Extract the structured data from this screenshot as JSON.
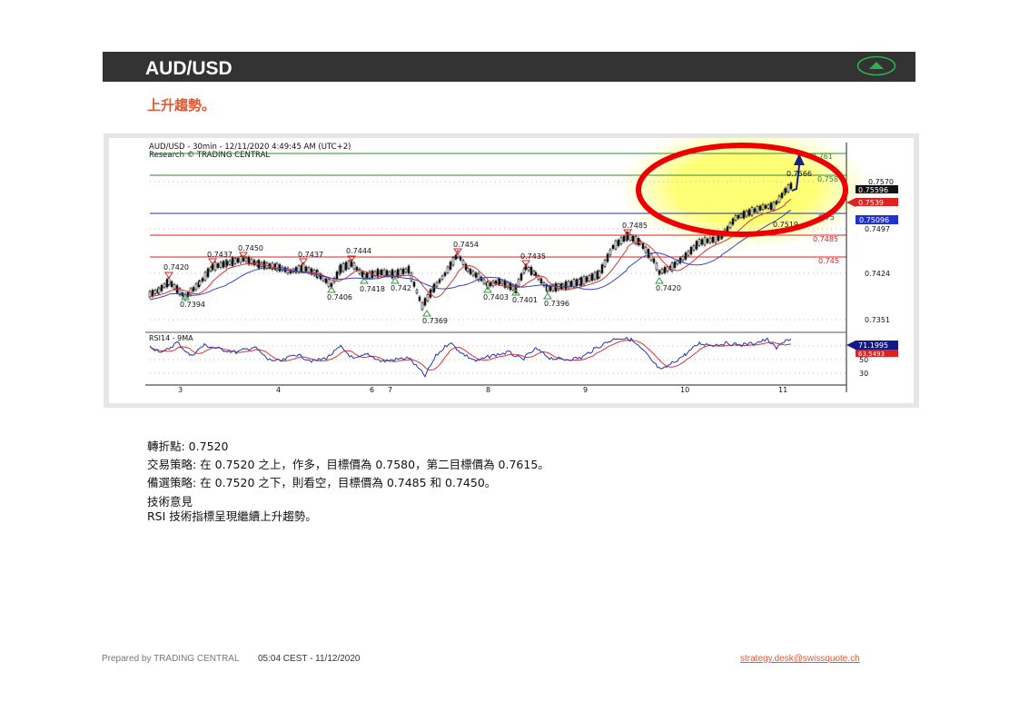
{
  "header": {
    "pair": "AUD/USD",
    "trend_icon": "up-triangle-icon",
    "accent_color": "#e8552a",
    "bar_color": "#333333"
  },
  "subtitle": "上升趨勢。",
  "chart": {
    "header_line": "AUD/USD - 30min - 12/11/2020 4:49:45 AM (UTC+2)",
    "research_line": "Research © TRADING CENTRAL",
    "levels": [
      {
        "label": "0.761",
        "color": "#2e8b3a"
      },
      {
        "label": "0.758",
        "color": "#2e8b3a"
      },
      {
        "label": "0.75",
        "color": "#2233aa"
      },
      {
        "label": "0.7485",
        "color": "#dd2222"
      },
      {
        "label": "0.745",
        "color": "#dd2222"
      }
    ],
    "price_axis": [
      "0.7570",
      "0.7497",
      "0.7424",
      "0.7351"
    ],
    "price_tags": {
      "current": "0.75596",
      "red": "0.7539",
      "blue": "0.75096"
    },
    "peaks": [
      "0.7420",
      "0.7437",
      "0.7450",
      "0.7437",
      "0.7444",
      "0.7454",
      "0.7435",
      "0.7485",
      "0.7566",
      "0.7519"
    ],
    "troughs": [
      "0.7394",
      "0.7406",
      "0.7418",
      "0.742",
      "0.7369",
      "0.7403",
      "0.7401",
      "0.7396",
      "0.7420"
    ],
    "rsi_title": "RSI14 - 9MA",
    "rsi_axis": [
      "50",
      "30"
    ],
    "rsi_tags": {
      "blue": "71.1995",
      "red": "63.5493"
    },
    "dates": [
      "3",
      "4",
      "6",
      "7",
      "8",
      "9",
      "10",
      "11"
    ]
  },
  "analysis": {
    "pivot": "轉折點: 0.7520",
    "trade": "交易策略: 在 0.7520 之上，作多，目標價為  0.7580，第二目標價為  0.7615。",
    "alt": "備選策略: 在 0.7520 之下，則看空，目標價為  0.7485 和 0.7450。",
    "tech_head": "技術意見",
    "tech_body": "RSI 技術指標呈現繼續上升趨勢。"
  },
  "footer": {
    "prepared": "Prepared by TRADING CENTRAL",
    "time": "05:04 CEST - 11/12/2020",
    "email": "strategy.desk@swissquote.ch"
  }
}
